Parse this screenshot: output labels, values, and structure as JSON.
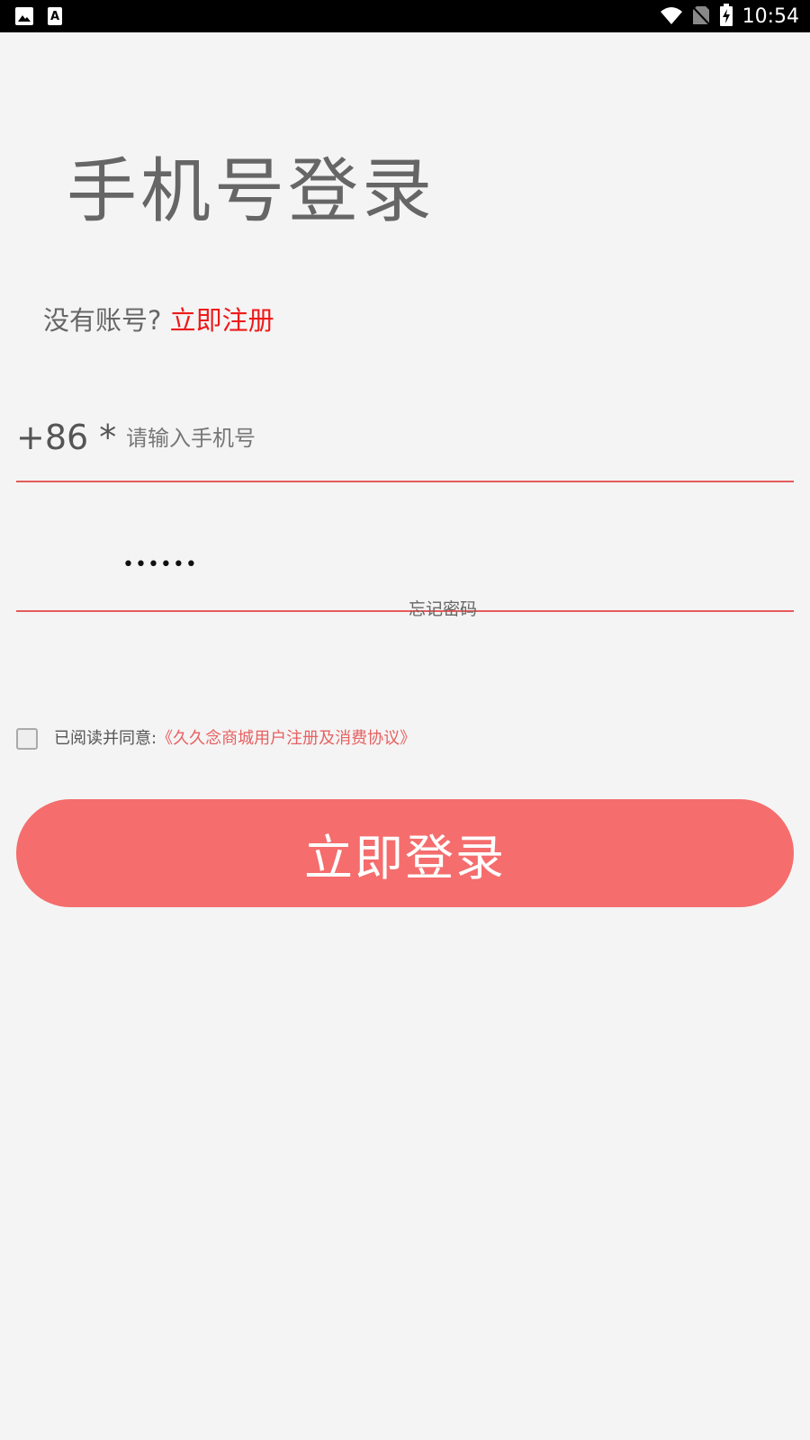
{
  "status_bar": {
    "time": "10:54",
    "left_icons": [
      "image-icon",
      "text-a-icon"
    ],
    "right_icons": [
      "wifi-icon",
      "no-sim-icon",
      "battery-charging-icon"
    ]
  },
  "title": "手机号登录",
  "register": {
    "prompt": "没有账号?",
    "link": "立即注册"
  },
  "phone": {
    "country_code": "+86 *",
    "placeholder": "请输入手机号"
  },
  "password": {
    "masked_value": "••••••"
  },
  "forgot_password": "忘记密码",
  "agreement": {
    "checked": false,
    "text": "已阅读并同意:",
    "link": "《久久念商城用户注册及消费协议》"
  },
  "login_button": "立即登录",
  "colors": {
    "accent": "#f56d6d",
    "link_red": "#ee1a1a",
    "underline": "#e55a5a",
    "background": "#f4f4f4"
  }
}
